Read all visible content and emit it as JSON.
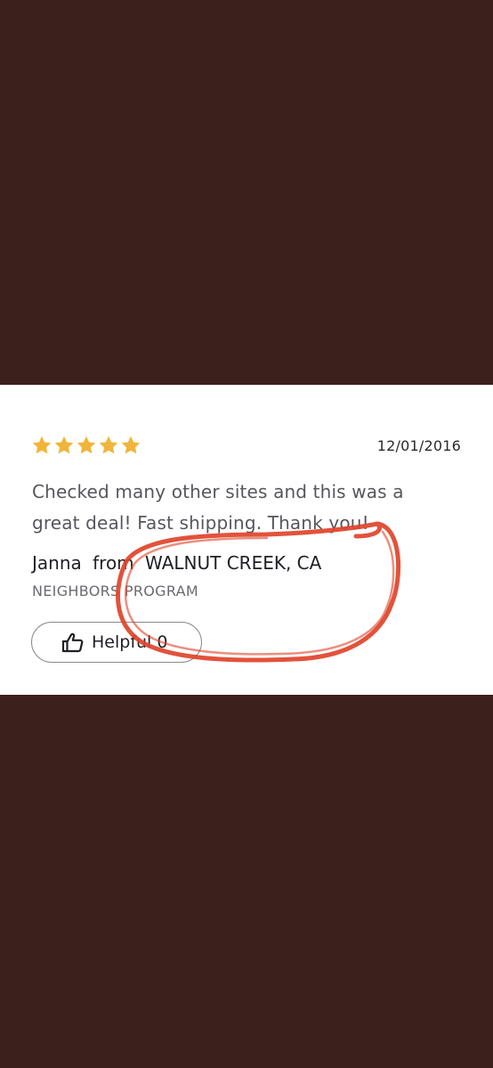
{
  "review": {
    "rating": 5,
    "max_rating": 5,
    "date": "12/01/2016",
    "text": "Checked many other sites and this was a great deal! Fast shipping. Thank you!",
    "reviewer_name": "Janna",
    "from_word": "from",
    "location": "WALNUT CREEK, CA",
    "program": "NEIGHBORS PROGRAM"
  },
  "helpful": {
    "label": "Helpful",
    "count": "0"
  },
  "colors": {
    "background": "#3b211b",
    "card": "#ffffff",
    "star": "#f0b53a",
    "annotation": "#e0432a"
  },
  "icons": {
    "star": "star-icon",
    "thumb": "thumbs-up-icon"
  }
}
